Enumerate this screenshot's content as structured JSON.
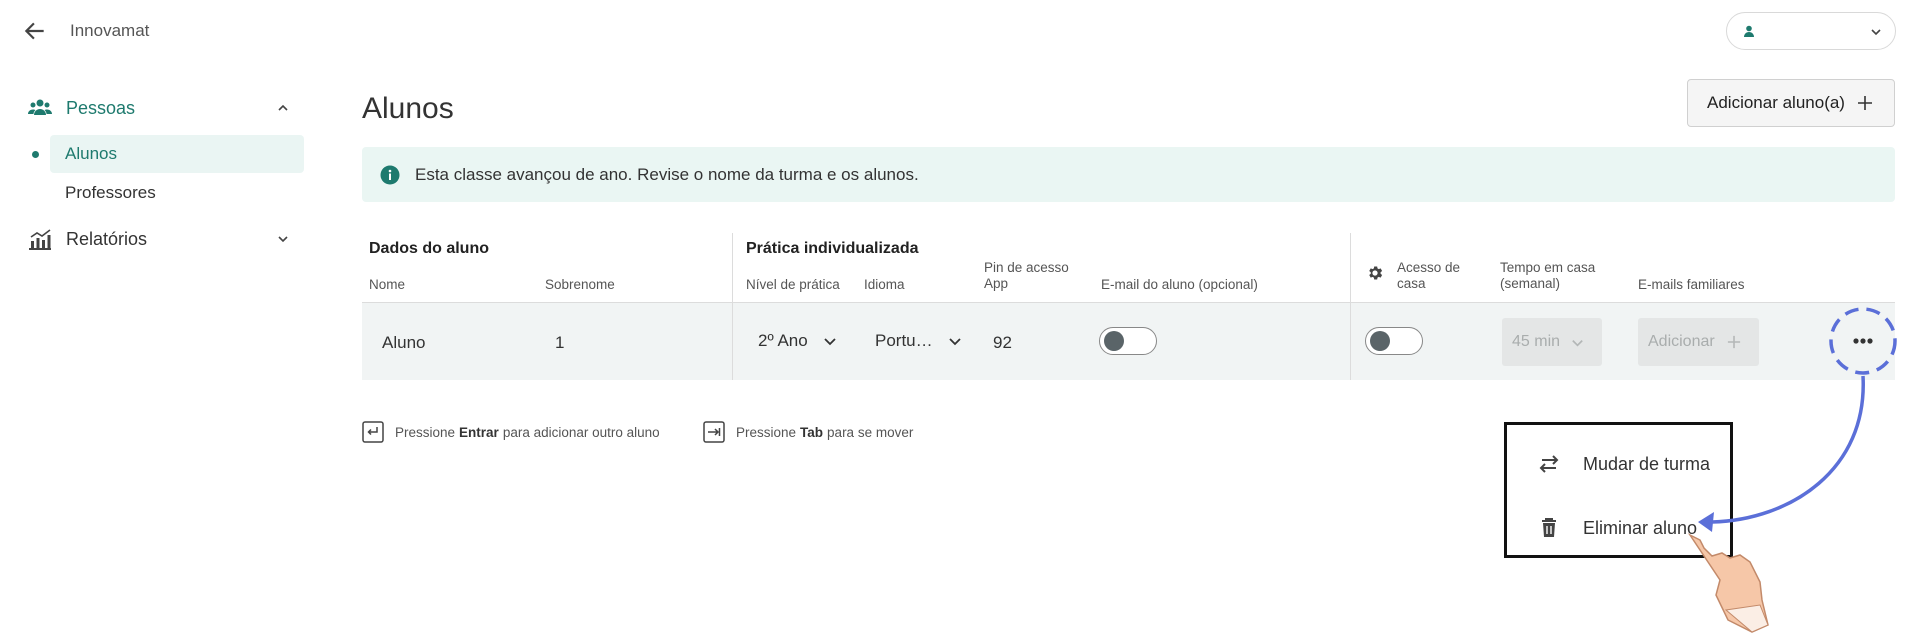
{
  "header": {
    "brand": "Innovamat"
  },
  "sidebar": {
    "groups": [
      {
        "label": "Pessoas",
        "icon": "people-icon",
        "items": [
          {
            "label": "Alunos",
            "active": true
          },
          {
            "label": "Professores",
            "active": false
          }
        ]
      },
      {
        "label": "Relatórios",
        "icon": "chart-icon"
      }
    ]
  },
  "main": {
    "title": "Alunos",
    "add_button": "Adicionar aluno(a)",
    "alert": "Esta classe avançou de ano. Revise o nome da turma e os alunos."
  },
  "table": {
    "groups": [
      "Dados do aluno",
      "Prática individualizada"
    ],
    "columns": {
      "nome": "Nome",
      "sobrenome": "Sobrenome",
      "nivel": "Nível de prática",
      "idioma": "Idioma",
      "pin_line1": "Pin de acesso",
      "pin_line2": "App",
      "email": "E-mail do aluno (opcional)",
      "acesso_line1": "Acesso de",
      "acesso_line2": "casa",
      "tempo_line1": "Tempo em casa",
      "tempo_line2": "(semanal)",
      "familiares": "E-mails familiares"
    },
    "row": {
      "nome": "Aluno",
      "sobrenome": "1",
      "nivel": "2º Ano",
      "idioma": "Portu…",
      "pin": "92",
      "email_toggle": false,
      "acesso_toggle": false,
      "tempo": "45 min",
      "familiares_button": "Adicionar"
    }
  },
  "hints": {
    "enter_pre": "Pressione",
    "enter_key": "Entrar",
    "enter_post": "para adicionar outro aluno",
    "tab_pre": "Pressione",
    "tab_key": "Tab",
    "tab_post": "para se mover"
  },
  "menu": {
    "items": [
      {
        "label": "Mudar de turma",
        "icon": "swap-icon"
      },
      {
        "label": "Eliminar aluno",
        "icon": "trash-icon"
      }
    ]
  },
  "colors": {
    "accent": "#1e7a6e",
    "annotation": "#5b6fd8"
  }
}
